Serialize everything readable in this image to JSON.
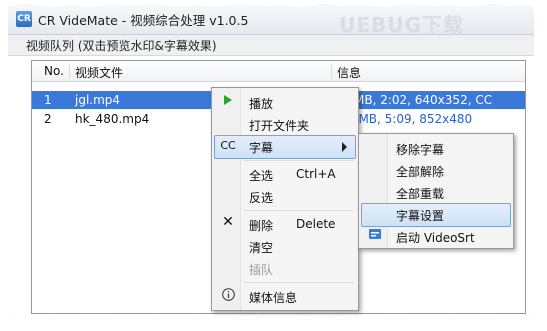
{
  "window": {
    "title": "CR VideMate - 视频综合处理 v1.0.5",
    "app_icon_text": "CR",
    "watermark": "UEBUG下载"
  },
  "group_label": "视频队列 (双击预览水印&字幕效果)",
  "table": {
    "columns": [
      "No.",
      "视频文件",
      "信息"
    ],
    "rows": [
      {
        "no": "1",
        "file": "jgl.mp4",
        "info": "MB, 2:02, 640x352, CC",
        "selected": true
      },
      {
        "no": "2",
        "file": "hk_480.mp4",
        "info": "3 MB, 5:09, 852x480",
        "selected": false
      }
    ]
  },
  "context_menu": {
    "items": [
      {
        "label": "播放",
        "icon": "play-icon"
      },
      {
        "label": "打开文件夹"
      },
      {
        "label": "字幕",
        "icon_text": "CC",
        "has_submenu": true,
        "highlighted": true
      },
      {
        "label": "全选",
        "shortcut": "Ctrl+A"
      },
      {
        "label": "反选"
      },
      {
        "label": "删除",
        "shortcut": "Delete",
        "icon": "close-icon"
      },
      {
        "label": "清空"
      },
      {
        "label": "插队",
        "disabled": true
      },
      {
        "label": "媒体信息",
        "icon": "info-icon"
      }
    ]
  },
  "submenu": {
    "items": [
      {
        "label": "移除字幕"
      },
      {
        "label": "全部解除"
      },
      {
        "label": "全部重载"
      },
      {
        "label": "字幕设置",
        "highlighted": true
      },
      {
        "label": "启动 VideoSrt",
        "icon": "videosrt-icon"
      }
    ]
  },
  "colors": {
    "selection": "#3b78d8",
    "info_text": "#2a62c9",
    "play_icon": "#2aa52a"
  }
}
